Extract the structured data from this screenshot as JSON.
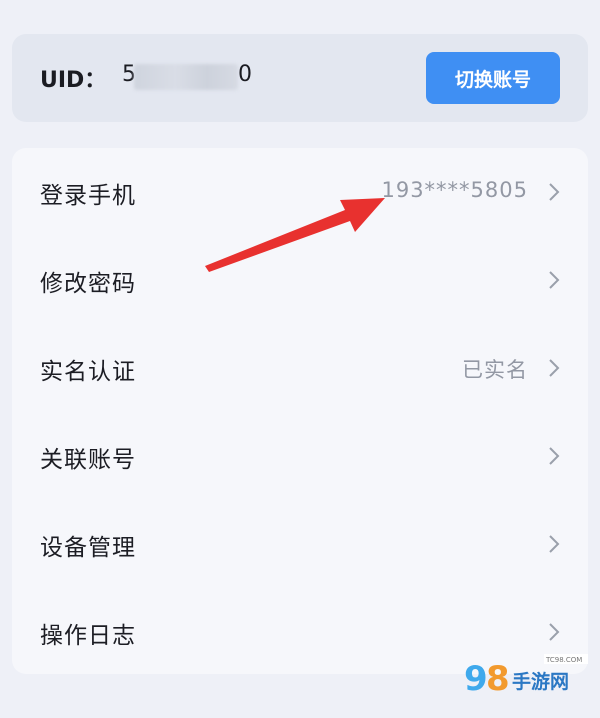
{
  "account": {
    "uid_label": "UID：",
    "uid_visible_start": "5",
    "uid_visible_end": "0",
    "switch_button": "切换账号"
  },
  "menu": {
    "items": [
      {
        "label": "登录手机",
        "value": "193****5805",
        "icon": "chevron-right-icon"
      },
      {
        "label": "修改密码",
        "value": "",
        "icon": "chevron-right-icon"
      },
      {
        "label": "实名认证",
        "value": "已实名",
        "icon": "chevron-right-icon"
      },
      {
        "label": "关联账号",
        "value": "",
        "icon": "chevron-right-icon"
      },
      {
        "label": "设备管理",
        "value": "",
        "icon": "chevron-right-icon"
      },
      {
        "label": "操作日志",
        "value": "",
        "icon": "chevron-right-icon"
      }
    ]
  },
  "annotation": {
    "arrow_color": "#e8312f"
  },
  "watermark": {
    "brand": "手游网",
    "digits": "98",
    "site": "TC98.COM"
  },
  "colors": {
    "accent": "#3f8ff3",
    "secondary_text": "#9398a4"
  }
}
